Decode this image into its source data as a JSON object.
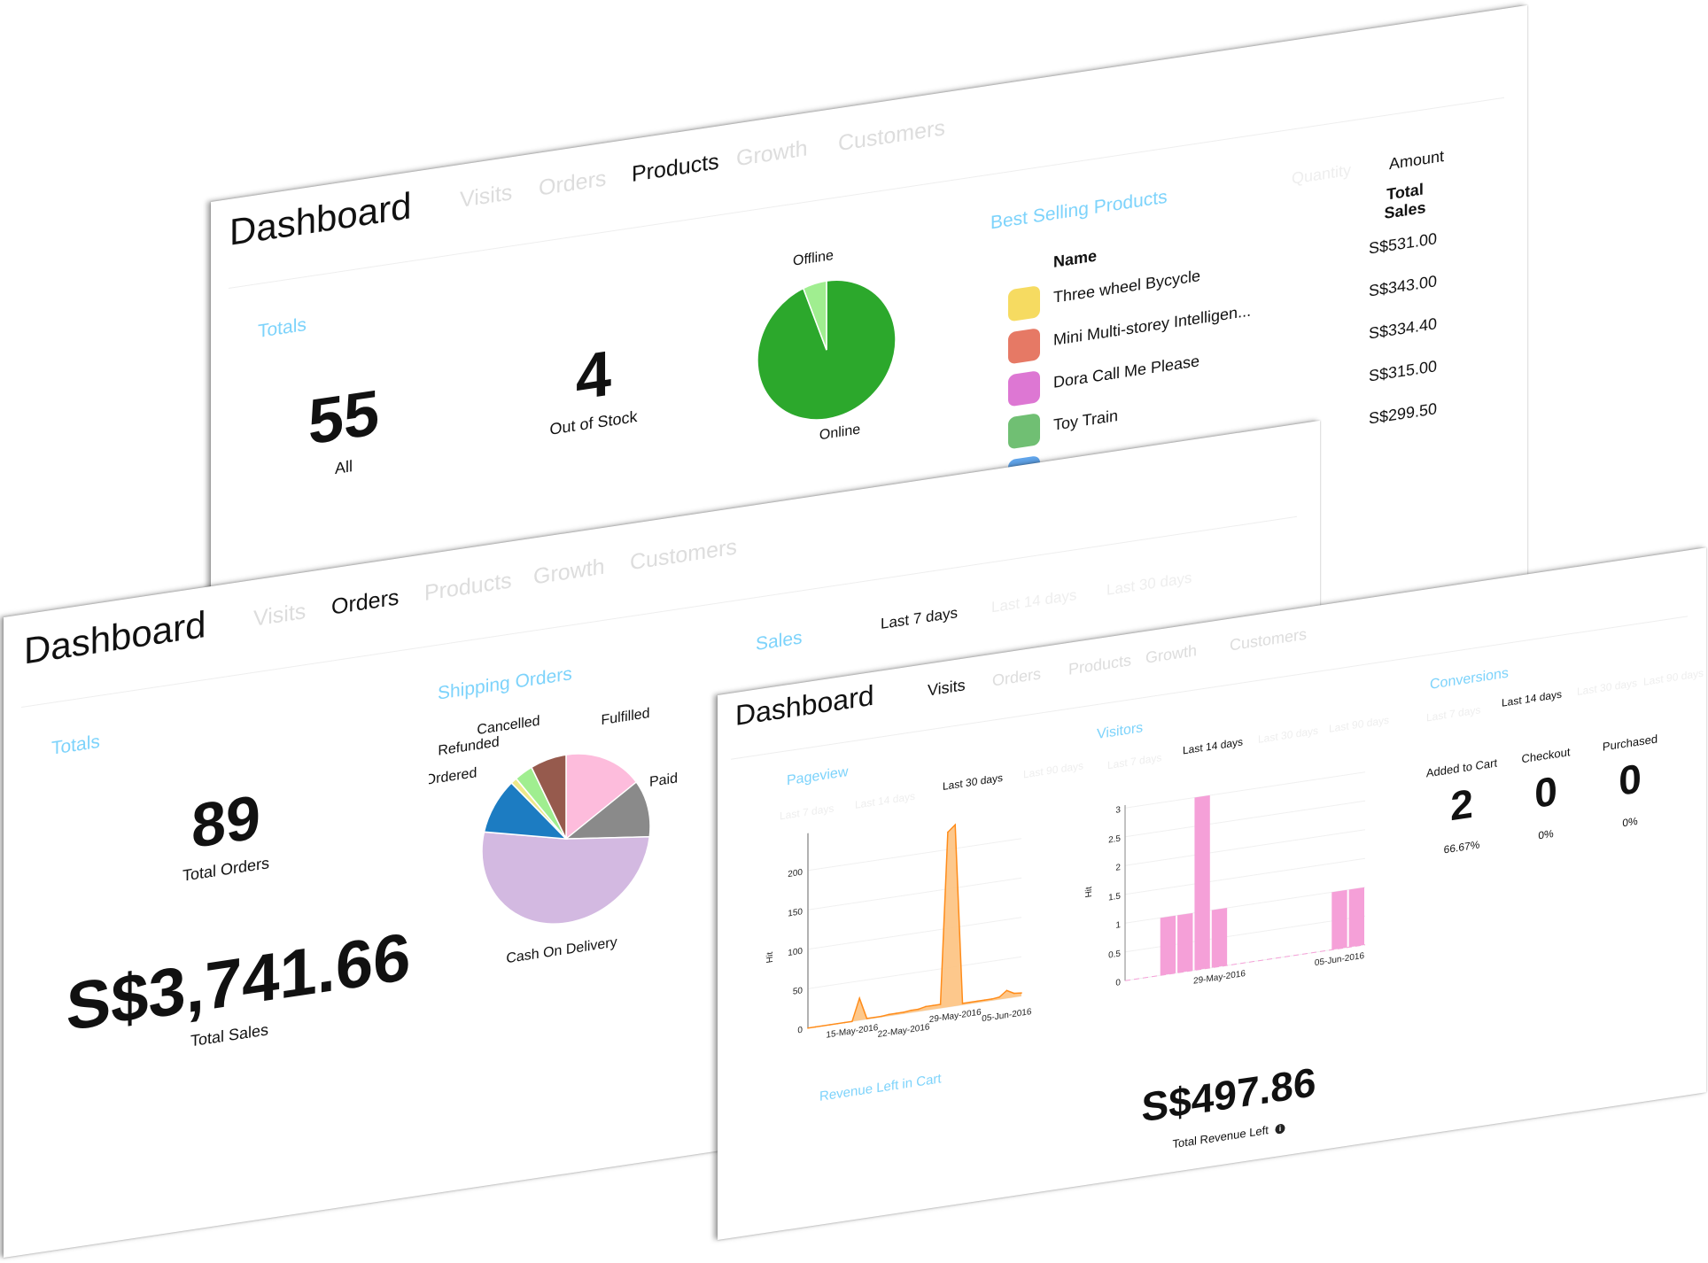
{
  "colors": {
    "accent": "#7dd3fb",
    "online": "#2ca82c",
    "offline": "#a0ee90",
    "pageview_line": "#ff8c1a",
    "pageview_fill": "#fdc27f",
    "visitor_bar": "#f5a0d8"
  },
  "products_panel": {
    "title": "Dashboard",
    "tabs": [
      {
        "label": "Visits",
        "active": false
      },
      {
        "label": "Orders",
        "active": false
      },
      {
        "label": "Products",
        "active": true
      },
      {
        "label": "Growth",
        "active": false
      },
      {
        "label": "Customers",
        "active": false
      }
    ],
    "totals_label": "Totals",
    "all_value": "55",
    "all_label": "All",
    "out_of_stock_value": "4",
    "out_of_stock_label": "Out of Stock",
    "best_selling_title": "Best Selling Products",
    "toggle": {
      "quantity": "Quantity",
      "amount": "Amount"
    },
    "table_headers": {
      "name": "Name",
      "total_sales": "Total Sales"
    },
    "products": [
      {
        "name": "Three wheel Bycycle",
        "total_sales": "S$531.00",
        "icon": "tricycle-icon"
      },
      {
        "name": "Mini Multi-storey Intelligen...",
        "total_sales": "S$343.00",
        "icon": "parking-garage-toy-icon"
      },
      {
        "name": "Dora Call Me Please",
        "total_sales": "S$334.40",
        "icon": "toy-phone-icon"
      },
      {
        "name": "Toy Train",
        "total_sales": "S$315.00",
        "icon": "toy-train-icon"
      },
      {
        "name": "",
        "total_sales": "S$299.50",
        "icon": "toy-icon"
      }
    ]
  },
  "orders_panel": {
    "title": "Dashboard",
    "tabs": [
      {
        "label": "Visits",
        "active": false
      },
      {
        "label": "Orders",
        "active": true
      },
      {
        "label": "Products",
        "active": false
      },
      {
        "label": "Growth",
        "active": false
      },
      {
        "label": "Customers",
        "active": false
      }
    ],
    "totals_label": "Totals",
    "total_orders_value": "89",
    "total_orders_label": "Total Orders",
    "total_sales_value": "S$3,741.66",
    "total_sales_label": "Total Sales",
    "shipping_title": "Shipping Orders",
    "sales_title": "Sales",
    "ranges": [
      "Last 7 days",
      "Last 14 days",
      "Last 30 days"
    ],
    "active_range": "Last 7 days"
  },
  "visits_panel": {
    "title": "Dashboard",
    "tabs": [
      {
        "label": "Visits",
        "active": true
      },
      {
        "label": "Orders",
        "active": false
      },
      {
        "label": "Products",
        "active": false
      },
      {
        "label": "Growth",
        "active": false
      },
      {
        "label": "Customers",
        "active": false
      }
    ],
    "pageview_title": "Pageview",
    "pageview_ranges": [
      "Last 7 days",
      "Last 14 days",
      "Last 30 days",
      "Last 90 days"
    ],
    "pageview_active": "Last 30 days",
    "visitors_title": "Visitors",
    "visitors_ranges": [
      "Last 7 days",
      "Last 14 days",
      "Last 30 days",
      "Last 90 days"
    ],
    "visitors_active": "Last 14 days",
    "conversions_title": "Conversions",
    "conversions_ranges": [
      "Last 7 days",
      "Last 14 days",
      "Last 30 days",
      "Last 90 days"
    ],
    "conversions_active": "Last 14 days",
    "conversions": [
      {
        "label": "Added to Cart",
        "value": "2",
        "percent": "66.67%"
      },
      {
        "label": "Checkout",
        "value": "0",
        "percent": "0%"
      },
      {
        "label": "Purchased",
        "value": "0",
        "percent": "0%"
      }
    ],
    "revenue_title": "Revenue Left in Cart",
    "revenue_value": "S$497.86",
    "revenue_label": "Total Revenue Left",
    "info_icon": "info-icon"
  },
  "chart_data": [
    {
      "type": "pie",
      "id": "product-status",
      "slices": [
        {
          "name": "Online",
          "value": 52,
          "color": "#2ca82c"
        },
        {
          "name": "Offline",
          "value": 3,
          "color": "#a0ee90"
        }
      ]
    },
    {
      "type": "pie",
      "id": "shipping-orders",
      "title": "Shipping Orders",
      "slices": [
        {
          "name": "Fulfilled",
          "value": 14,
          "color": "#fdbcdc"
        },
        {
          "name": "Paid",
          "value": 10,
          "color": "#8a8a8a"
        },
        {
          "name": "Cash On Delivery",
          "value": 46,
          "color": "#d3b9e1"
        },
        {
          "name": "Ordered",
          "value": 9,
          "color": "#1c7cc2"
        },
        {
          "name": "",
          "value": 1,
          "color": "#eee98a"
        },
        {
          "name": "Refunded",
          "value": 3,
          "color": "#a0ee90"
        },
        {
          "name": "Cancelled",
          "value": 6,
          "color": "#965a4d"
        }
      ]
    },
    {
      "type": "area",
      "id": "pageview",
      "ylabel": "Hit",
      "ylim": [
        0,
        240
      ],
      "yticks": [
        0,
        50,
        100,
        150,
        200
      ],
      "xtick_labels": [
        "15-May-2016",
        "22-May-2016",
        "29-May-2016",
        "05-Jun-2016"
      ],
      "x": [
        "09-May-2016",
        "10-May-2016",
        "11-May-2016",
        "12-May-2016",
        "13-May-2016",
        "14-May-2016",
        "15-May-2016",
        "16-May-2016",
        "17-May-2016",
        "18-May-2016",
        "19-May-2016",
        "20-May-2016",
        "21-May-2016",
        "22-May-2016",
        "23-May-2016",
        "24-May-2016",
        "25-May-2016",
        "26-May-2016",
        "27-May-2016",
        "28-May-2016",
        "29-May-2016",
        "30-May-2016",
        "31-May-2016",
        "01-Jun-2016",
        "02-Jun-2016",
        "03-Jun-2016",
        "04-Jun-2016",
        "05-Jun-2016",
        "06-Jun-2016",
        "07-Jun-2016"
      ],
      "values": [
        0,
        0,
        0,
        0,
        0,
        0,
        0,
        28,
        1,
        1,
        1,
        2,
        2,
        2,
        3,
        3,
        5,
        5,
        5,
        222,
        230,
        2,
        2,
        2,
        2,
        2,
        3,
        10,
        5,
        4
      ]
    },
    {
      "type": "bar",
      "id": "visitors",
      "ylabel": "Hit",
      "ylim": [
        0,
        3
      ],
      "yticks": [
        0,
        0.5,
        1,
        1.5,
        2,
        2.5,
        3
      ],
      "xtick_labels": [
        "29-May-2016",
        "05-Jun-2016"
      ],
      "x": [
        "24-May-2016",
        "25-May-2016",
        "26-May-2016",
        "27-May-2016",
        "28-May-2016",
        "29-May-2016",
        "30-May-2016",
        "31-May-2016",
        "01-Jun-2016",
        "02-Jun-2016",
        "03-Jun-2016",
        "04-Jun-2016",
        "05-Jun-2016",
        "06-Jun-2016"
      ],
      "values": [
        0,
        0,
        1,
        1,
        3,
        1,
        0,
        0,
        0,
        0,
        0,
        0,
        1,
        1
      ]
    }
  ]
}
